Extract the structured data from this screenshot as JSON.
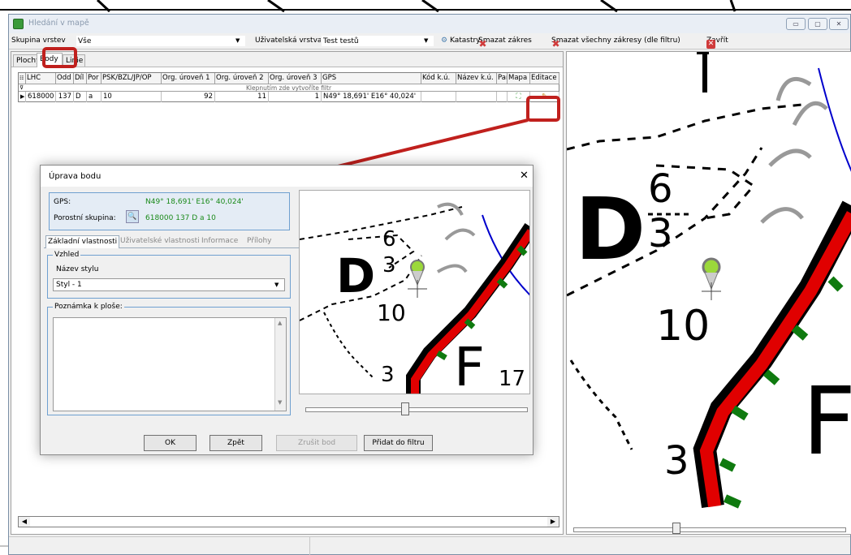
{
  "window": {
    "title": "Hledání v mapě"
  },
  "toolbar": {
    "layer_group_label": "Skupina vrstev",
    "layer_group_value": "Vše",
    "user_layer_label": "Uživatelská vrstva",
    "user_layer_value": "Test testů",
    "cadastre_btn": "Katastry",
    "delete_btn": "Smazat zákres",
    "delete_all_btn": "Smazat všechny zákresy (dle filtru)",
    "close_btn": "Zavřít"
  },
  "tabs": [
    "Plochy",
    "Body",
    "Linie"
  ],
  "grid": {
    "headers": [
      "LHC",
      "Odd",
      "Díl",
      "Por",
      "PSK/BZL/JP/OP",
      "Org. úroveň 1",
      "Org. úroveň 2",
      "Org. úroveň 3",
      "GPS",
      "Kód k.ú.",
      "Název k.ú.",
      "Par",
      "Mapa",
      "Editace"
    ],
    "filter_hint": "Klepnutím zde vytvoříte filtr",
    "row": {
      "lhc": "618000",
      "odd": "137",
      "dil": "D",
      "por": "a",
      "psk": "10",
      "org1": "92",
      "org2": "11",
      "org3": "1",
      "gps": "N49° 18,691' E16° 40,024'"
    }
  },
  "dialog": {
    "title": "Úprava bodu",
    "gps_label": "GPS:",
    "gps_value": "N49° 18,691' E16° 40,024'",
    "stand_label": "Porostní skupina:",
    "stand_value": "618000  137  D  a  10",
    "tabs": [
      "Základní vlastnosti",
      "Uživatelské vlastnosti",
      "Informace",
      "Přílohy"
    ],
    "appearance_legend": "Vzhled",
    "style_label": "Název stylu",
    "style_value": "Styl - 1",
    "note_legend": "Poznámka k ploše:",
    "buttons": {
      "ok": "OK",
      "back": "Zpět",
      "cancel_point": "Zrušit bod",
      "add_filter": "Přidat do filtru"
    }
  },
  "map_labels": {
    "num6": "6",
    "num3": "3",
    "letterD": "D",
    "num10": "10",
    "letterF": "F",
    "num17": "17",
    "num3b": "3"
  },
  "colors": {
    "accent_red": "#c0201d",
    "forest_red": "#e00000",
    "forest_green": "#0f7a0f",
    "info_bg": "#e4ecf5"
  }
}
